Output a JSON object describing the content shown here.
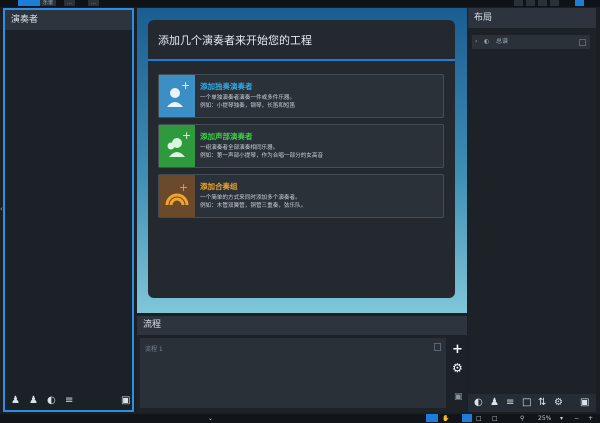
{
  "top_tabs": [
    {
      "label": "乐谱"
    },
    {
      "label": "…"
    },
    {
      "label": "…"
    }
  ],
  "left_panel": {
    "title": "演奏者"
  },
  "center": {
    "heading": "添加几个演奏者来开始您的工程",
    "options": [
      {
        "title": "添加独奏演奏者",
        "desc1": "一个单独演奏者演奏一件或多件乐器。",
        "desc2": "例如：小提琴独奏，钢琴，长笛和短笛",
        "color": "#2fa9e8"
      },
      {
        "title": "添加声部演奏者",
        "desc1": "一组演奏者全部演奏相同乐器。",
        "desc2": "例如：第一声部小提琴，作为合唱一部分的女高音",
        "color": "#3ad04a"
      },
      {
        "title": "添加合奏组",
        "desc1": "一个简单的方式来同时添加多个演奏者。",
        "desc2": "例如：木管双簧管，铜管三重奏，弦乐队。",
        "color": "#f0a52a"
      }
    ]
  },
  "process": {
    "title": "流程",
    "item": "流程 1"
  },
  "layout": {
    "title": "布局",
    "row": "总谱"
  },
  "status": {
    "zoom": "25%"
  },
  "icons": {
    "plus": "plus-icon",
    "gear": "gear-icon",
    "trash": "trash-icon"
  }
}
